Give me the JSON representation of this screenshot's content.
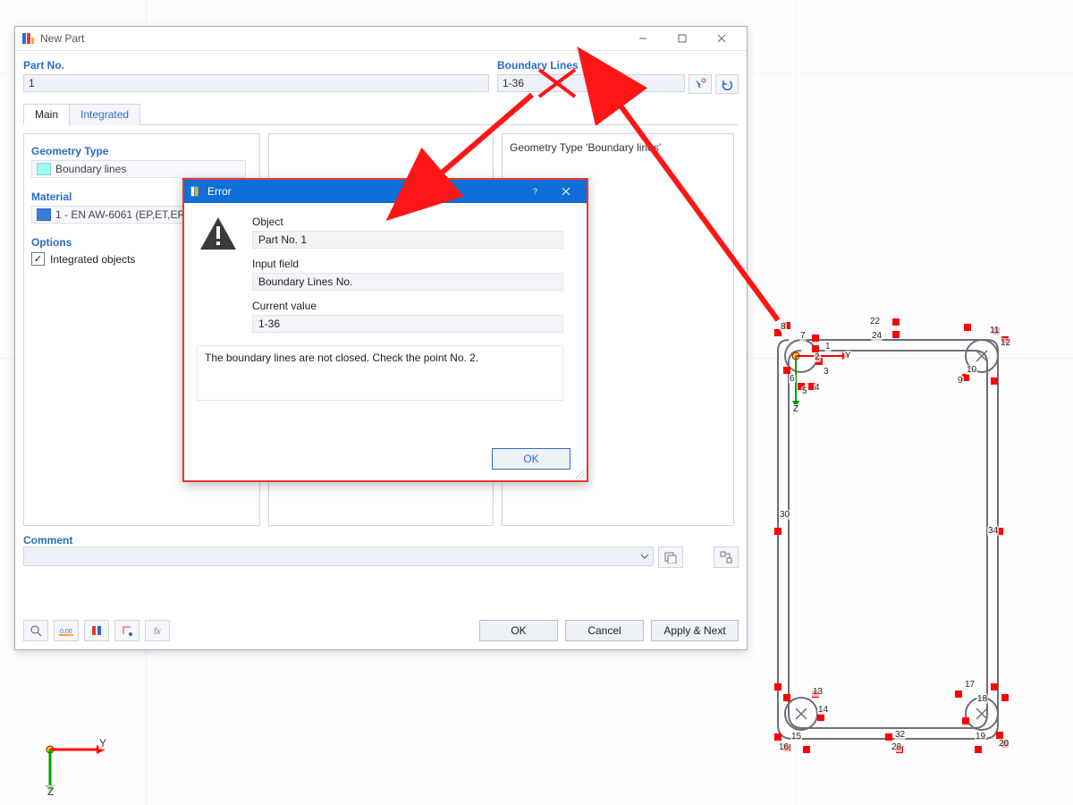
{
  "colors": {
    "accent": "#2b6cc4",
    "error": "#e53935",
    "modalBar": "#0f6fd6"
  },
  "window": {
    "title": "New Part",
    "partNoLabel": "Part No.",
    "partNoValue": "1",
    "boundaryLabel": "Boundary Lines No.",
    "boundaryValue": "1-36",
    "tabs": {
      "main": "Main",
      "integrated": "Integrated"
    },
    "geometryTypeLabel": "Geometry Type",
    "geometryTypeValue": "Boundary lines",
    "materialLabel": "Material",
    "materialValue": "1 - EN AW-6061 (EP,ET,ER/B)",
    "optionsLabel": "Options",
    "integratedObjects": "Integrated objects",
    "rightPanelTitle": "Geometry Type 'Boundary lines'",
    "commentLabel": "Comment",
    "buttons": {
      "ok": "OK",
      "cancel": "Cancel",
      "applyNext": "Apply & Next"
    }
  },
  "modal": {
    "title": "Error",
    "objectLabel": "Object",
    "objectValue": "Part No. 1",
    "inputFieldLabel": "Input field",
    "inputFieldValue": "Boundary Lines No.",
    "currentValueLabel": "Current value",
    "currentValue": "1-36",
    "message": "The boundary lines are not closed. Check the point No. 2.",
    "ok": "OK"
  },
  "gizmo": {
    "y": "Y",
    "z": "Z"
  },
  "sketch": {
    "axis": {
      "y": "Y",
      "z": "Z"
    },
    "numbers": {
      "n1": "1",
      "n2": "2",
      "n3": "3",
      "n4": "4",
      "n5": "5",
      "n6": "6",
      "n7": "7",
      "n8": "8",
      "n9": "9",
      "n10": "10",
      "n11": "11",
      "n12": "12",
      "n13": "13",
      "n14": "14",
      "n15": "15",
      "n16": "16",
      "n17": "17",
      "n18": "18",
      "n19": "19",
      "n20": "20",
      "n22": "22",
      "n24": "24",
      "n28": "28",
      "n30": "30",
      "n32": "32",
      "n34": "34"
    }
  }
}
